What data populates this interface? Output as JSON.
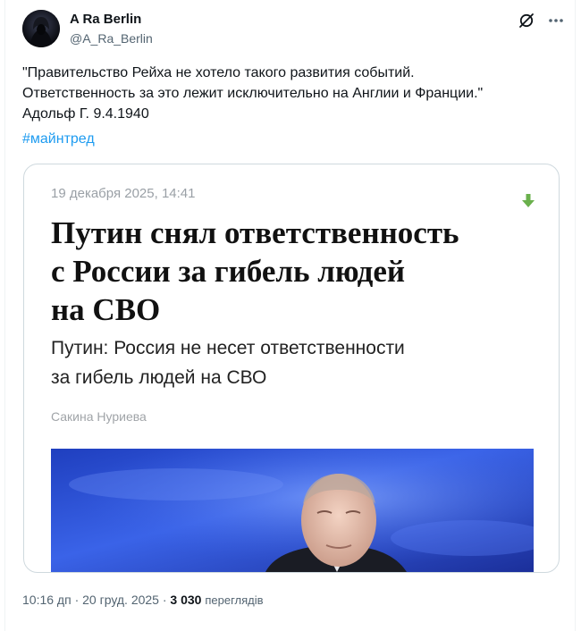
{
  "tweet": {
    "author": {
      "display_name": "A Ra Berlin",
      "handle": "@A_Ra_Berlin"
    },
    "text_lines": [
      "\"Правительство Рейха не хотело такого развития событий.",
      "Ответственность за это лежит исключительно на Англии и Франции.\"",
      "Адольф Г. 9.4.1940"
    ],
    "hashtag": "#майнтред",
    "time": "10:16 дп",
    "date": "20 груд. 2025",
    "views_count": "3 030",
    "views_label": "переглядів",
    "separator": " · "
  },
  "card": {
    "date": "19 декабря 2025, 14:41",
    "title_lines": [
      "Путин снял ответственность",
      "с России за гибель людей",
      "на СВО"
    ],
    "subtitle_lines": [
      "Путин: Россия не несет ответственности",
      "за гибель людей на СВО"
    ],
    "author": "Сакина Нуриева"
  },
  "icons": {
    "header_left": "grok-icon",
    "header_right": "more-icon",
    "card_arrow": "download-arrow-icon"
  },
  "colors": {
    "link": "#1d9bf0",
    "arrow": "#6ab04c",
    "stage_blue": "#2a4fd6"
  }
}
